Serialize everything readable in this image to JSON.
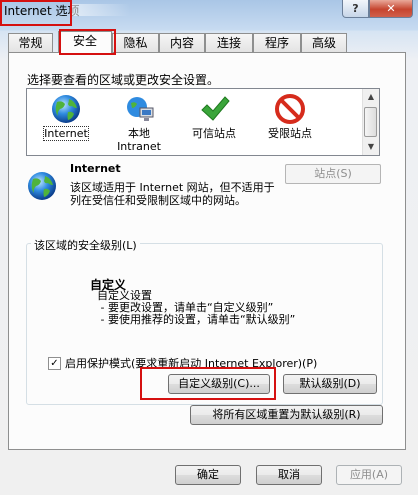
{
  "window": {
    "title": "Internet 选项",
    "help_glyph": "?",
    "close_glyph": "✕"
  },
  "tabs": [
    {
      "label": "常规"
    },
    {
      "label": "安全",
      "active": true
    },
    {
      "label": "隐私"
    },
    {
      "label": "内容"
    },
    {
      "label": "连接"
    },
    {
      "label": "程序"
    },
    {
      "label": "高级"
    }
  ],
  "security": {
    "instruction": "选择要查看的区域或更改安全设置。",
    "zones": [
      {
        "label": "Internet",
        "icon": "globe-icon",
        "selected": true
      },
      {
        "label": "本地\nIntranet",
        "icon": "intranet-icon"
      },
      {
        "label": "可信站点",
        "icon": "check-icon"
      },
      {
        "label": "受限站点",
        "icon": "forbidden-icon"
      }
    ],
    "zone_name": "Internet",
    "zone_description": "该区域适用于 Internet 网站，但不适用于列在受信任和受限制区域中的网站。",
    "sites_button": "站点(S)",
    "level_group_label": "该区域的安全级别(L)",
    "custom_title": "自定义",
    "custom_description": "自定义设置\n - 要更改设置，请单击“自定义级别”\n - 要使用推荐的设置，请单击“默认级别”",
    "protected_mode_label": "启用保护模式(要求重新启动 Internet Explorer)(P)",
    "protected_mode_checked": true,
    "custom_level_button": "自定义级别(C)...",
    "default_level_button": "默认级别(D)",
    "reset_all_button": "将所有区域重置为默认级别(R)"
  },
  "footer": {
    "ok": "确定",
    "cancel": "取消",
    "apply": "应用(A)"
  },
  "colors": {
    "highlight_box": "#d51010",
    "check_green": "#3aa53a",
    "forbidden_red": "#d62b1c"
  }
}
